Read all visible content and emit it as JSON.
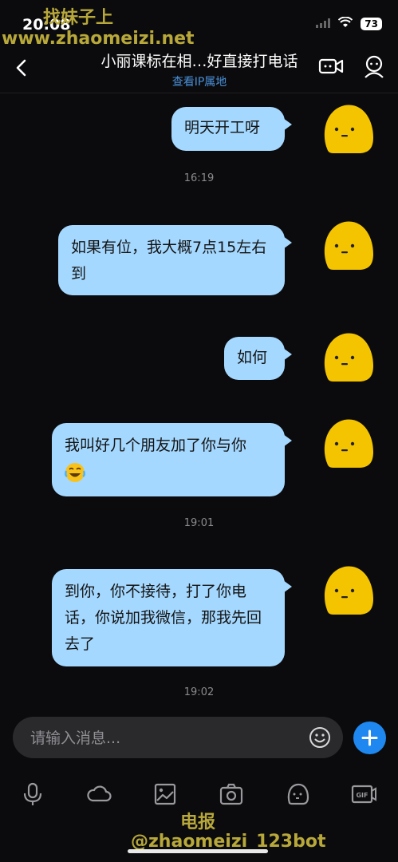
{
  "status_bar": {
    "time": "20:08",
    "battery": "73"
  },
  "watermark": {
    "line1": "找妹子上",
    "line2": "www.zhaomeizi.net",
    "line3": "电报",
    "line4": "@zhaomeizi_123bot"
  },
  "header": {
    "title": "小丽课标在相…好直接打电话",
    "subtitle": "查看IP属地"
  },
  "messages": [
    {
      "text": "明天开工呀"
    },
    {
      "text": "如果有位，我大概7点15左右到"
    },
    {
      "text": "如何"
    },
    {
      "text": "我叫好几个朋友加了你与你"
    },
    {
      "text": "到你，你不接待，打了你电话，你说加我微信，那我先回去了"
    }
  ],
  "timestamps": [
    "16:19",
    "19:01",
    "19:02"
  ],
  "input": {
    "placeholder": "请输入消息..."
  },
  "toolbar": [
    "mic-icon",
    "cloud-icon",
    "image-icon",
    "camera-icon",
    "sticker-icon",
    "gif-icon"
  ],
  "colors": {
    "bubble": "#a5d8ff",
    "accent": "#1e88f0",
    "avatar": "#f5c400",
    "background": "#0b0b0d"
  }
}
